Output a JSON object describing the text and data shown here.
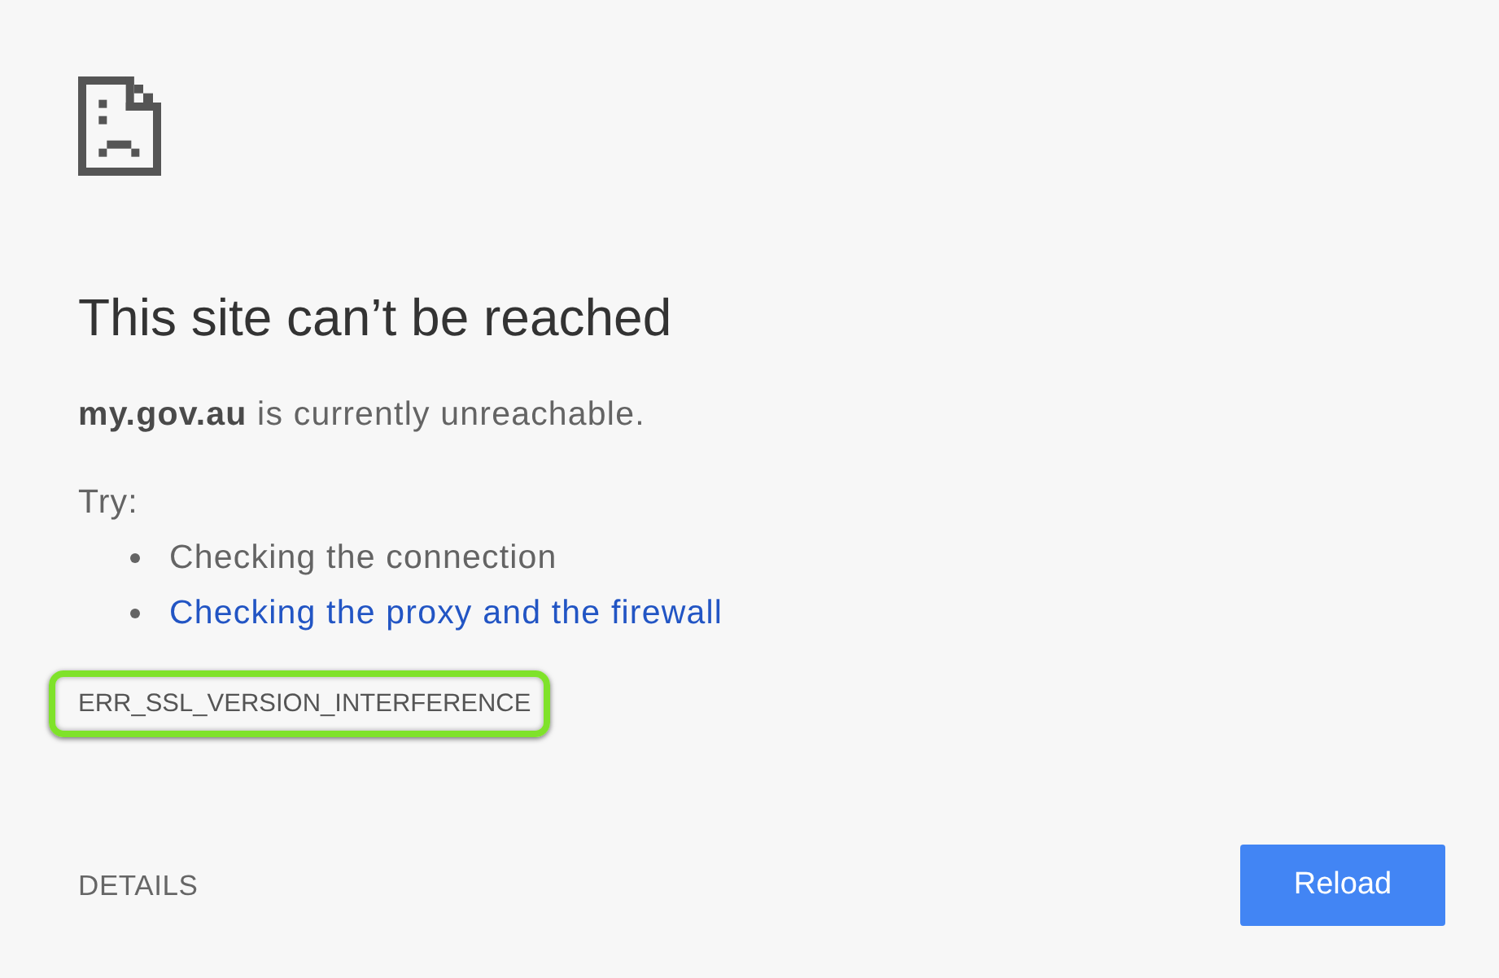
{
  "heading": "This site can’t be reached",
  "message": "**my.gov.au** is currently unreachable.",
  "suggestions": {
    "label": "Try:",
    "items": [
      {
        "text": "Checking the connection",
        "kind": "text"
      },
      {
        "text": "Checking the proxy and the firewall",
        "kind": "link"
      }
    ]
  },
  "error_code": {
    "text": "ERR_SSL_VERSION_INTERFERENCE",
    "highlighted": true
  },
  "footer": {
    "details": "DETAILS",
    "reload": "Reload"
  }
}
